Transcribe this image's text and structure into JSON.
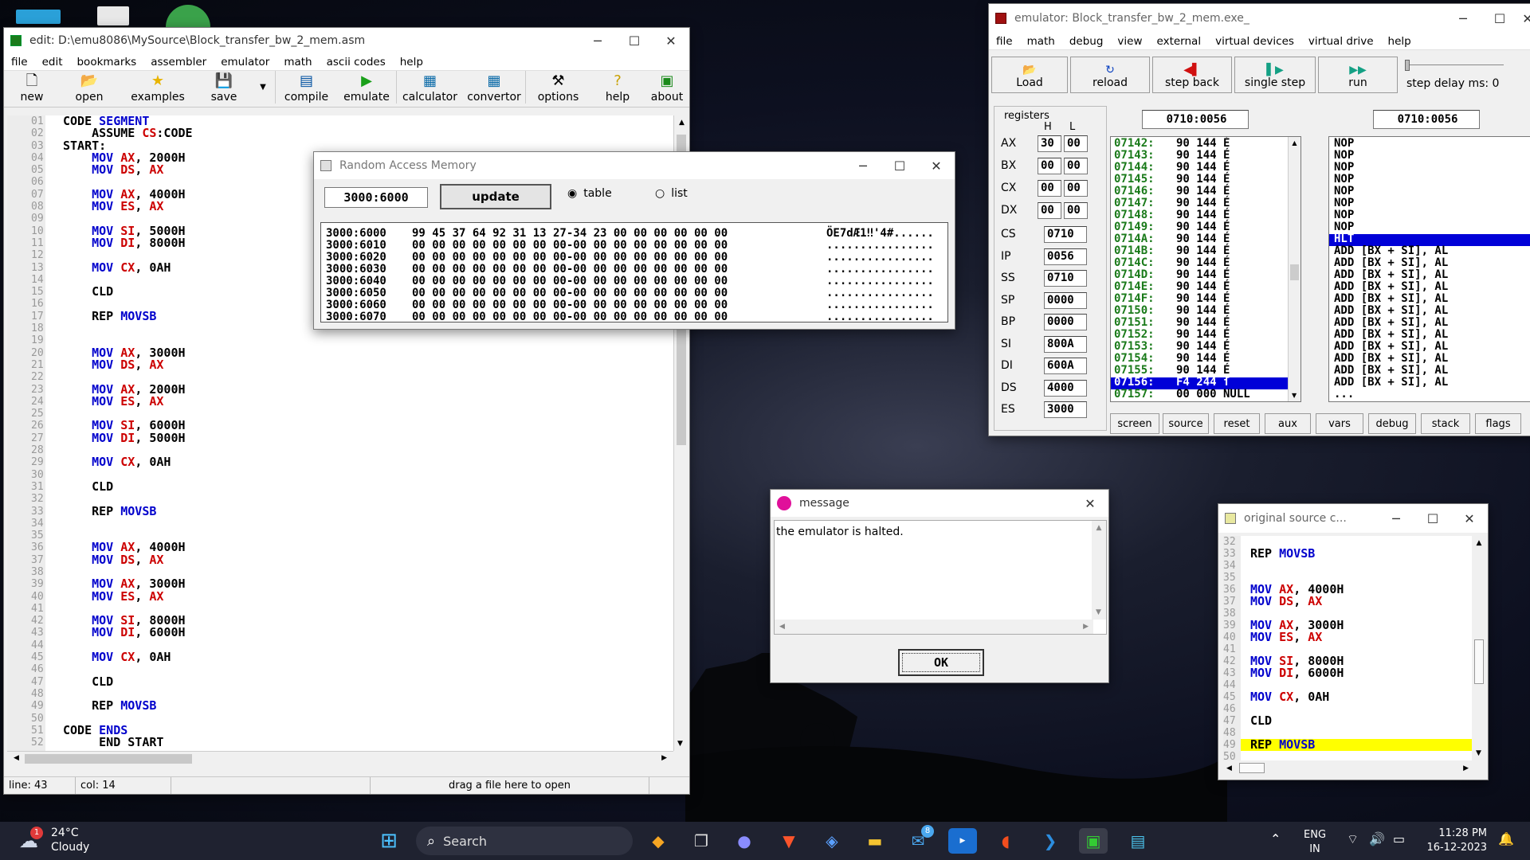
{
  "editor": {
    "title": "edit: D:\\emu8086\\MySource\\Block_transfer_bw_2_mem.asm",
    "menu": [
      "file",
      "edit",
      "bookmarks",
      "assembler",
      "emulator",
      "math",
      "ascii codes",
      "help"
    ],
    "toolbar": [
      "new",
      "open",
      "examples",
      "save",
      "compile",
      "emulate",
      "calculator",
      "convertor",
      "options",
      "help",
      "about"
    ],
    "lines": [
      {
        "n": "01",
        "t": "CODE SEGMENT"
      },
      {
        "n": "02",
        "t": "    ASSUME CS:CODE"
      },
      {
        "n": "03",
        "t": "START:"
      },
      {
        "n": "04",
        "t": "    MOV AX, 2000H"
      },
      {
        "n": "05",
        "t": "    MOV DS, AX"
      },
      {
        "n": "06",
        "t": ""
      },
      {
        "n": "07",
        "t": "    MOV AX, 4000H"
      },
      {
        "n": "08",
        "t": "    MOV ES, AX"
      },
      {
        "n": "09",
        "t": ""
      },
      {
        "n": "10",
        "t": "    MOV SI, 5000H"
      },
      {
        "n": "11",
        "t": "    MOV DI, 8000H"
      },
      {
        "n": "12",
        "t": ""
      },
      {
        "n": "13",
        "t": "    MOV CX, 0AH"
      },
      {
        "n": "14",
        "t": ""
      },
      {
        "n": "15",
        "t": "    CLD"
      },
      {
        "n": "16",
        "t": ""
      },
      {
        "n": "17",
        "t": "    REP MOVSB"
      },
      {
        "n": "18",
        "t": ""
      },
      {
        "n": "19",
        "t": ""
      },
      {
        "n": "20",
        "t": "    MOV AX, 3000H"
      },
      {
        "n": "21",
        "t": "    MOV DS, AX"
      },
      {
        "n": "22",
        "t": ""
      },
      {
        "n": "23",
        "t": "    MOV AX, 2000H"
      },
      {
        "n": "24",
        "t": "    MOV ES, AX"
      },
      {
        "n": "25",
        "t": ""
      },
      {
        "n": "26",
        "t": "    MOV SI, 6000H"
      },
      {
        "n": "27",
        "t": "    MOV DI, 5000H"
      },
      {
        "n": "28",
        "t": ""
      },
      {
        "n": "29",
        "t": "    MOV CX, 0AH"
      },
      {
        "n": "30",
        "t": ""
      },
      {
        "n": "31",
        "t": "    CLD"
      },
      {
        "n": "32",
        "t": ""
      },
      {
        "n": "33",
        "t": "    REP MOVSB"
      },
      {
        "n": "34",
        "t": ""
      },
      {
        "n": "35",
        "t": ""
      },
      {
        "n": "36",
        "t": "    MOV AX, 4000H"
      },
      {
        "n": "37",
        "t": "    MOV DS, AX"
      },
      {
        "n": "38",
        "t": ""
      },
      {
        "n": "39",
        "t": "    MOV AX, 3000H"
      },
      {
        "n": "40",
        "t": "    MOV ES, AX"
      },
      {
        "n": "41",
        "t": ""
      },
      {
        "n": "42",
        "t": "    MOV SI, 8000H"
      },
      {
        "n": "43",
        "t": "    MOV DI, 6000H"
      },
      {
        "n": "44",
        "t": ""
      },
      {
        "n": "45",
        "t": "    MOV CX, 0AH"
      },
      {
        "n": "46",
        "t": ""
      },
      {
        "n": "47",
        "t": "    CLD"
      },
      {
        "n": "48",
        "t": ""
      },
      {
        "n": "49",
        "t": "    REP MOVSB"
      },
      {
        "n": "50",
        "t": ""
      },
      {
        "n": "51",
        "t": "CODE ENDS"
      },
      {
        "n": "52",
        "t": "     END START"
      }
    ],
    "status": {
      "line": "line: 43",
      "col": "col: 14",
      "drop": "drag a file here to open"
    }
  },
  "ram": {
    "title": "Random Access Memory",
    "address": "3000:6000",
    "update": "update",
    "table": "table",
    "list": "list",
    "rows": [
      {
        "a": "3000:6000",
        "h": "99 45 37 64 92 31 13 27-34 23 00 00 00 00 00 00",
        "c": "ÖE7dÆ1‼'4#......"
      },
      {
        "a": "3000:6010",
        "h": "00 00 00 00 00 00 00 00-00 00 00 00 00 00 00 00",
        "c": "................"
      },
      {
        "a": "3000:6020",
        "h": "00 00 00 00 00 00 00 00-00 00 00 00 00 00 00 00",
        "c": "................"
      },
      {
        "a": "3000:6030",
        "h": "00 00 00 00 00 00 00 00-00 00 00 00 00 00 00 00",
        "c": "................"
      },
      {
        "a": "3000:6040",
        "h": "00 00 00 00 00 00 00 00-00 00 00 00 00 00 00 00",
        "c": "................"
      },
      {
        "a": "3000:6050",
        "h": "00 00 00 00 00 00 00 00-00 00 00 00 00 00 00 00",
        "c": "................"
      },
      {
        "a": "3000:6060",
        "h": "00 00 00 00 00 00 00 00-00 00 00 00 00 00 00 00",
        "c": "................"
      },
      {
        "a": "3000:6070",
        "h": "00 00 00 00 00 00 00 00-00 00 00 00 00 00 00 00",
        "c": "................"
      }
    ]
  },
  "emu": {
    "title": "emulator: Block_transfer_bw_2_mem.exe_",
    "menu": [
      "file",
      "math",
      "debug",
      "view",
      "external",
      "virtual devices",
      "virtual drive",
      "help"
    ],
    "buttons": [
      "Load",
      "reload",
      "step back",
      "single step",
      "run"
    ],
    "step_delay": "step delay ms: 0",
    "registers_label": "registers",
    "h": "H",
    "l": "L",
    "regs8": [
      {
        "n": "AX",
        "h": "30",
        "l": "00"
      },
      {
        "n": "BX",
        "h": "00",
        "l": "00"
      },
      {
        "n": "CX",
        "h": "00",
        "l": "00"
      },
      {
        "n": "DX",
        "h": "00",
        "l": "00"
      }
    ],
    "regs16": [
      {
        "n": "CS",
        "v": "0710"
      },
      {
        "n": "IP",
        "v": "0056"
      },
      {
        "n": "SS",
        "v": "0710"
      },
      {
        "n": "SP",
        "v": "0000"
      },
      {
        "n": "BP",
        "v": "0000"
      },
      {
        "n": "SI",
        "v": "800A"
      },
      {
        "n": "DI",
        "v": "600A"
      },
      {
        "n": "DS",
        "v": "4000"
      },
      {
        "n": "ES",
        "v": "3000"
      }
    ],
    "addr1": "0710:0056",
    "addr2": "0710:0056",
    "mem": [
      {
        "a": "07142:",
        "b": "90 144 É"
      },
      {
        "a": "07143:",
        "b": "90 144 É"
      },
      {
        "a": "07144:",
        "b": "90 144 É"
      },
      {
        "a": "07145:",
        "b": "90 144 É"
      },
      {
        "a": "07146:",
        "b": "90 144 É"
      },
      {
        "a": "07147:",
        "b": "90 144 É"
      },
      {
        "a": "07148:",
        "b": "90 144 É"
      },
      {
        "a": "07149:",
        "b": "90 144 É"
      },
      {
        "a": "0714A:",
        "b": "90 144 É"
      },
      {
        "a": "0714B:",
        "b": "90 144 É"
      },
      {
        "a": "0714C:",
        "b": "90 144 É"
      },
      {
        "a": "0714D:",
        "b": "90 144 É"
      },
      {
        "a": "0714E:",
        "b": "90 144 É"
      },
      {
        "a": "0714F:",
        "b": "90 144 É"
      },
      {
        "a": "07150:",
        "b": "90 144 É"
      },
      {
        "a": "07151:",
        "b": "90 144 É"
      },
      {
        "a": "07152:",
        "b": "90 144 É"
      },
      {
        "a": "07153:",
        "b": "90 144 É"
      },
      {
        "a": "07154:",
        "b": "90 144 É"
      },
      {
        "a": "07155:",
        "b": "90 144 É"
      },
      {
        "a": "07156:",
        "b": "F4 244 ſ"
      },
      {
        "a": "07157:",
        "b": "00 000 NULL"
      }
    ],
    "mem_selected": 20,
    "disasm": [
      "NOP",
      "NOP",
      "NOP",
      "NOP",
      "NOP",
      "NOP",
      "NOP",
      "NOP",
      "HLT",
      "ADD [BX + SI], AL",
      "ADD [BX + SI], AL",
      "ADD [BX + SI], AL",
      "ADD [BX + SI], AL",
      "ADD [BX + SI], AL",
      "ADD [BX + SI], AL",
      "ADD [BX + SI], AL",
      "ADD [BX + SI], AL",
      "ADD [BX + SI], AL",
      "ADD [BX + SI], AL",
      "ADD [BX + SI], AL",
      "ADD [BX + SI], AL",
      "..."
    ],
    "disasm_selected": 8,
    "tabs": [
      "screen",
      "source",
      "reset",
      "aux",
      "vars",
      "debug",
      "stack",
      "flags"
    ]
  },
  "message": {
    "title": "message",
    "text": "the emulator is halted.",
    "ok": "OK"
  },
  "source": {
    "title": "original source c...",
    "lines": [
      {
        "n": "32",
        "t": ""
      },
      {
        "n": "33",
        "t": "REP MOVSB"
      },
      {
        "n": "34",
        "t": ""
      },
      {
        "n": "35",
        "t": ""
      },
      {
        "n": "36",
        "t": "MOV AX, 4000H"
      },
      {
        "n": "37",
        "t": "MOV DS, AX"
      },
      {
        "n": "38",
        "t": ""
      },
      {
        "n": "39",
        "t": "MOV AX, 3000H"
      },
      {
        "n": "40",
        "t": "MOV ES, AX"
      },
      {
        "n": "41",
        "t": ""
      },
      {
        "n": "42",
        "t": "MOV SI, 8000H"
      },
      {
        "n": "43",
        "t": "MOV DI, 6000H"
      },
      {
        "n": "44",
        "t": ""
      },
      {
        "n": "45",
        "t": "MOV CX, 0AH"
      },
      {
        "n": "46",
        "t": ""
      },
      {
        "n": "47",
        "t": "CLD"
      },
      {
        "n": "48",
        "t": ""
      },
      {
        "n": "49",
        "t": "REP MOVSB"
      },
      {
        "n": "50",
        "t": ""
      }
    ],
    "highlight": 17
  },
  "taskbar": {
    "temp": "24°C",
    "weather": "Cloudy",
    "badge": "1",
    "search": "Search",
    "mail_badge": "8",
    "lang1": "ENG",
    "lang2": "IN",
    "time": "11:28 PM",
    "date": "16-12-2023"
  }
}
